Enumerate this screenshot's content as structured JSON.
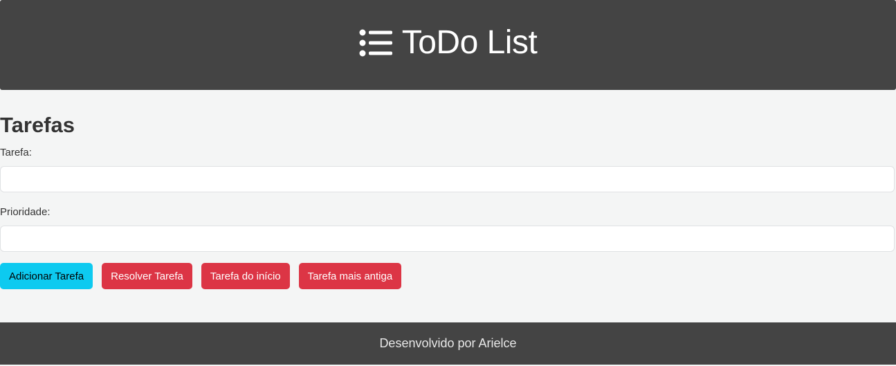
{
  "header": {
    "title": "ToDo List",
    "icon": "list-icon",
    "background": "#444444"
  },
  "main": {
    "section_title": "Tarefas",
    "task_label": "Tarefa:",
    "task_value": "",
    "priority_label": "Prioridade:",
    "priority_value": "",
    "buttons": {
      "add": "Adicionar Tarefa",
      "resolve": "Resolver Tarefa",
      "start": "Tarefa do início",
      "oldest": "Tarefa mais antiga"
    }
  },
  "footer": {
    "text": "Desenvolvido por Arielce"
  },
  "colors": {
    "page_bg": "#f4f5f5",
    "info": "#0dcaf0",
    "danger": "#dc3545"
  }
}
